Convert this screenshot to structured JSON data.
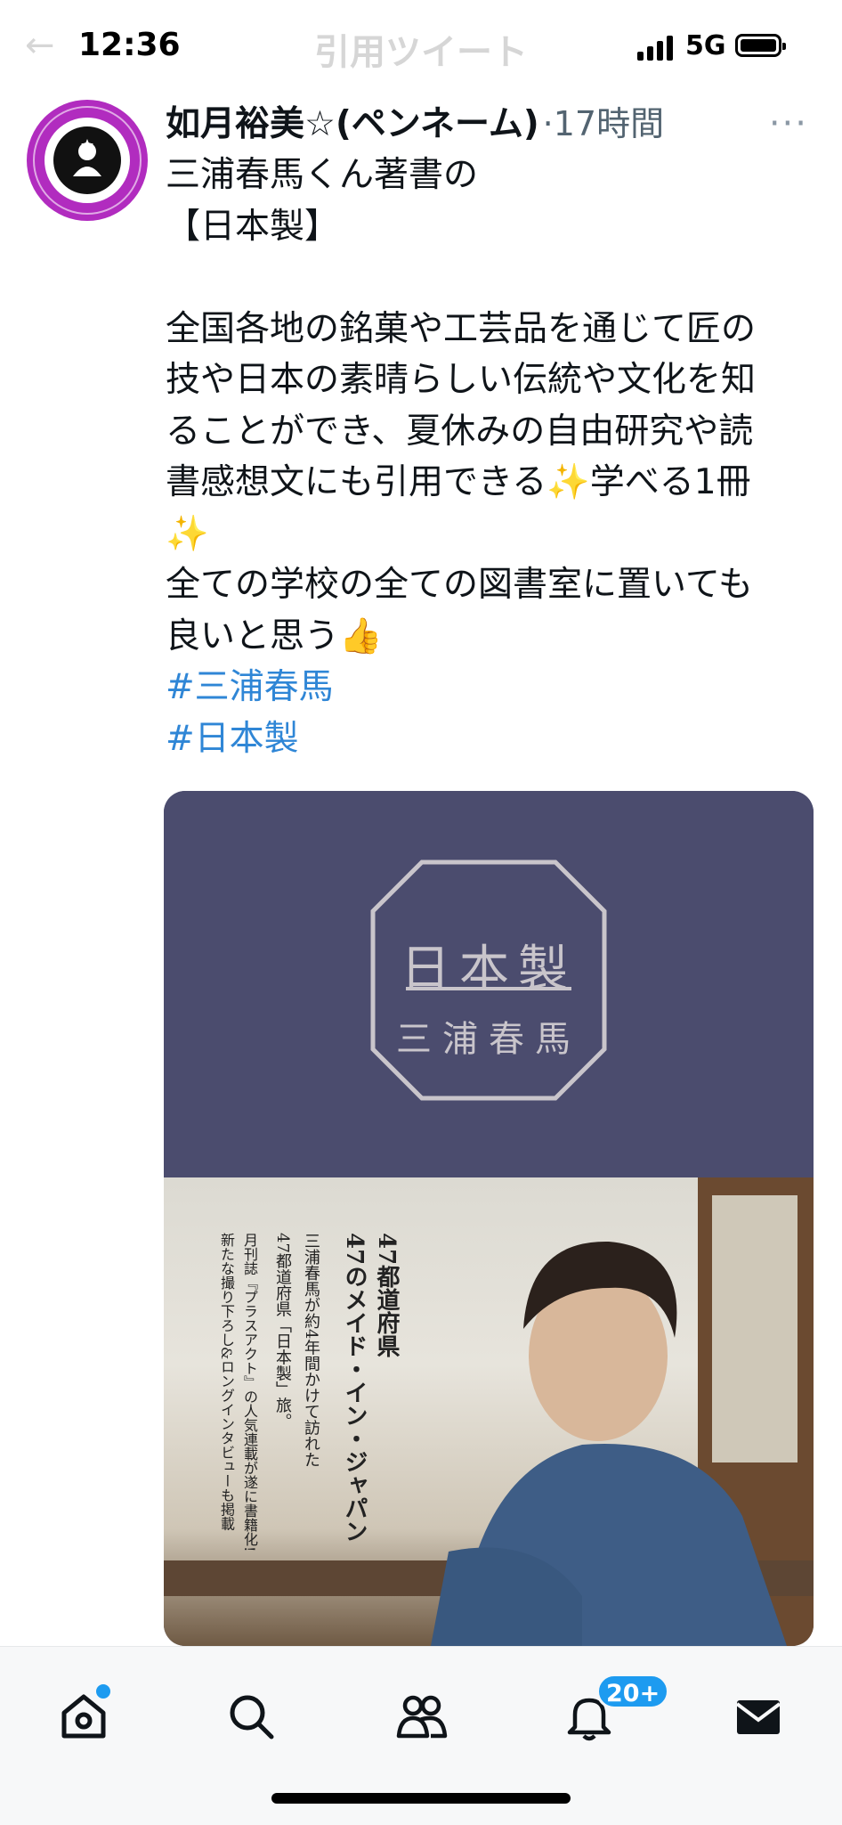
{
  "status_bar": {
    "time": "12:36",
    "network": "5G",
    "signal_icon": "signal-bars-icon",
    "battery_icon": "battery-icon"
  },
  "header": {
    "back_icon": "back-arrow-icon",
    "title": "引用ツイート"
  },
  "tweet": {
    "author_name": "如月裕美☆(ペンネーム)",
    "time_ago": "·17時間",
    "more_icon": "more-dots-icon",
    "lines": [
      "三浦春馬くん著書の",
      "【日本製】",
      "",
      "全国各地の銘菓や工芸品を通じて匠の",
      "技や日本の素晴らしい伝統や文化を知",
      "ることができ、夏休みの自由研究や読",
      "書感想文にも引用できる✨学べる1冊",
      "✨",
      "全ての学校の全ての図書室に置いても",
      "良いと思う👍"
    ],
    "hashtags": [
      "#三浦春馬",
      "#日本製"
    ]
  },
  "media": {
    "book_title": "日本製",
    "book_author": "三浦春馬",
    "cover_text": [
      "47都道府県",
      "47のメイド・イン・ジャパン",
      "三浦春馬が約4年間かけて訪れた",
      "47都道府県「日本製」旅。",
      "月刊誌『プラスアクト』の人気連載が遂に書籍化!",
      "新たな撮り下ろし&ロングインタビューも掲載"
    ],
    "colors": {
      "cover": "#4b4c6e",
      "emblem": "#c9c5cb"
    }
  },
  "tab_bar": {
    "tabs": [
      {
        "name": "home",
        "icon": "home-icon"
      },
      {
        "name": "search",
        "icon": "search-icon"
      },
      {
        "name": "communities",
        "icon": "people-icon"
      },
      {
        "name": "notifications",
        "icon": "bell-icon",
        "badge": "20+"
      },
      {
        "name": "messages",
        "icon": "mail-icon"
      }
    ]
  },
  "accent_color": "#1d9bf0"
}
